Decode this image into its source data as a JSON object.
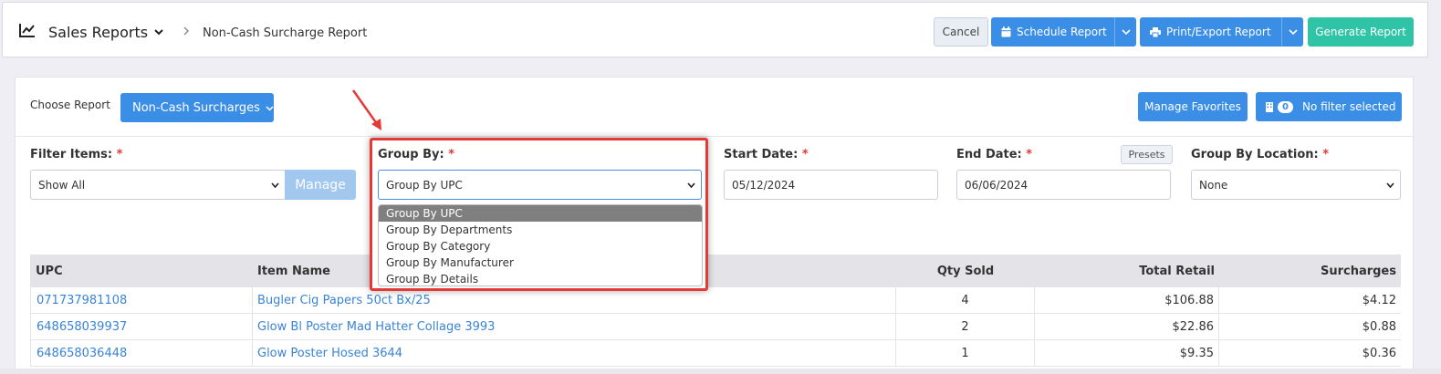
{
  "header": {
    "title": "Sales Reports",
    "breadcrumb": "Non-Cash Surcharge Report",
    "cancel_label": "Cancel",
    "schedule_label": "Schedule Report",
    "print_label": "Print/Export Report",
    "generate_label": "Generate Report"
  },
  "report": {
    "choose_label": "Choose Report",
    "selected": "Non-Cash Surcharges",
    "manage_favorites": "Manage Favorites",
    "filter_count": "0",
    "filter_text": "No filter selected"
  },
  "filters": {
    "filter_items_label": "Filter Items:",
    "filter_items_value": "Show All",
    "manage_label": "Manage",
    "group_by_label": "Group By:",
    "group_by_value": "Group By UPC",
    "group_by_options": [
      "Group By UPC",
      "Group By Departments",
      "Group By Category",
      "Group By Manufacturer",
      "Group By Details"
    ],
    "start_date_label": "Start Date:",
    "start_date_value": "05/12/2024",
    "end_date_label": "End Date:",
    "end_date_value": "06/06/2024",
    "presets_label": "Presets",
    "location_label": "Group By Location:",
    "location_value": "None",
    "required_mark": "*"
  },
  "table": {
    "headers": [
      "UPC",
      "Item Name",
      "Qty Sold",
      "Total Retail",
      "Surcharges"
    ],
    "rows": [
      [
        "071737981108",
        "Bugler Cig Papers 50ct Bx/25",
        "4",
        "$106.88",
        "$4.12"
      ],
      [
        "648658039937",
        "Glow Bl Poster Mad Hatter Collage 3993",
        "2",
        "$22.86",
        "$0.88"
      ],
      [
        "648658036448",
        "Glow Poster Hosed 3644",
        "1",
        "$9.35",
        "$0.36"
      ]
    ]
  },
  "colors": {
    "primary": "#3b8ee6",
    "success": "#2fc4a6",
    "highlight": "#e53935",
    "link": "#3a84d6"
  }
}
